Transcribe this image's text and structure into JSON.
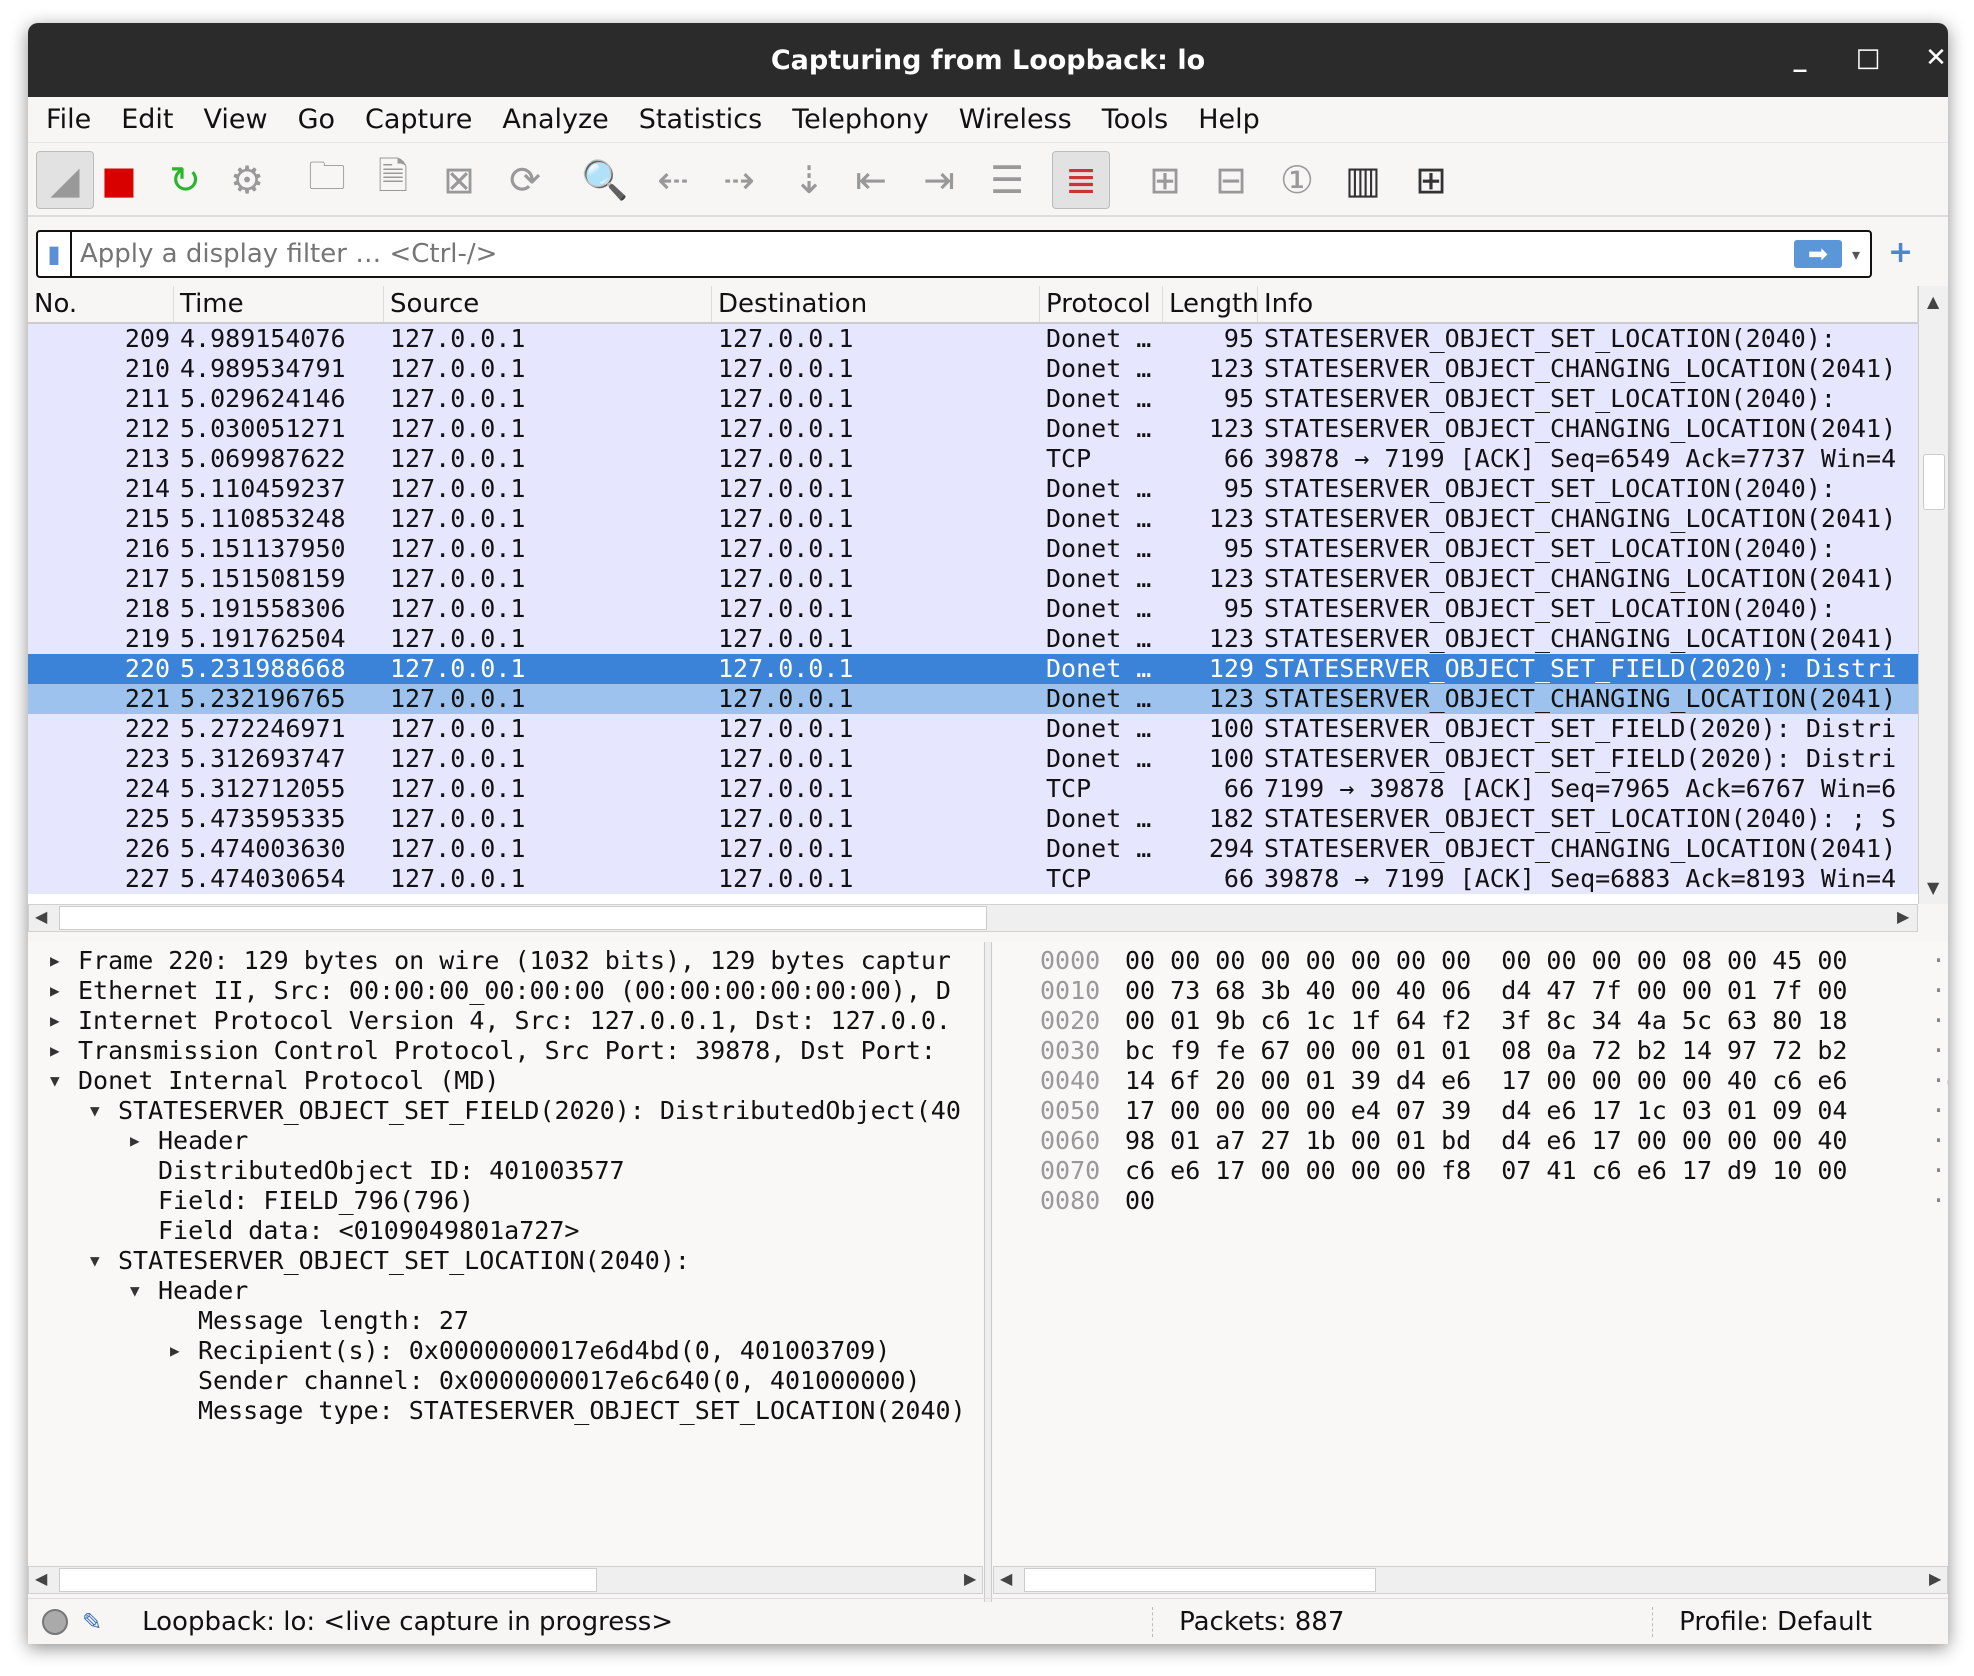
{
  "window": {
    "title": "Capturing from Loopback: lo",
    "minimize": "_",
    "maximize": "□",
    "close": "✕"
  },
  "menu": [
    "File",
    "Edit",
    "View",
    "Go",
    "Capture",
    "Analyze",
    "Statistics",
    "Telephony",
    "Wireless",
    "Tools",
    "Help"
  ],
  "toolbar": [
    {
      "name": "start-capture-icon",
      "glyph": "◢"
    },
    {
      "name": "stop-capture-icon",
      "glyph": "■",
      "color": "#d90000"
    },
    {
      "name": "restart-capture-icon",
      "glyph": "↻",
      "color": "#2ab52a"
    },
    {
      "name": "capture-options-icon",
      "glyph": "⚙"
    },
    {
      "name": "open-file-icon",
      "glyph": "🗀"
    },
    {
      "name": "save-file-icon",
      "glyph": "🗎"
    },
    {
      "name": "close-file-icon",
      "glyph": "⊠"
    },
    {
      "name": "reload-file-icon",
      "glyph": "⟳"
    },
    {
      "name": "find-packet-icon",
      "glyph": "🔍",
      "color": "#1d3d8f"
    },
    {
      "name": "go-back-icon",
      "glyph": "⇠"
    },
    {
      "name": "go-forward-icon",
      "glyph": "⇢"
    },
    {
      "name": "go-to-packet-icon",
      "glyph": "⇣"
    },
    {
      "name": "first-packet-icon",
      "glyph": "⇤"
    },
    {
      "name": "last-packet-icon",
      "glyph": "⇥"
    },
    {
      "name": "autoscroll-icon",
      "glyph": "☰"
    },
    {
      "name": "colorize-icon",
      "glyph": "≣",
      "color": "#c33"
    },
    {
      "name": "zoom-in-icon",
      "glyph": "⊞"
    },
    {
      "name": "zoom-out-icon",
      "glyph": "⊟"
    },
    {
      "name": "normal-size-icon",
      "glyph": "①"
    },
    {
      "name": "resize-columns-icon",
      "glyph": "▥",
      "color": "#333"
    },
    {
      "name": "layout-icon",
      "glyph": "⊞",
      "color": "#333"
    }
  ],
  "filter": {
    "placeholder": "Apply a display filter … <Ctrl-/>",
    "apply": "➡",
    "dropdown": "▾",
    "add": "+"
  },
  "columns": [
    "No.",
    "Time",
    "Source",
    "Destination",
    "Protocol",
    "Length",
    "Info"
  ],
  "packets": [
    [
      "209",
      "4.989154076",
      "127.0.0.1",
      "127.0.0.1",
      "Donet …",
      "95",
      "STATESERVER_OBJECT_SET_LOCATION(2040):"
    ],
    [
      "210",
      "4.989534791",
      "127.0.0.1",
      "127.0.0.1",
      "Donet …",
      "123",
      "STATESERVER_OBJECT_CHANGING_LOCATION(2041)"
    ],
    [
      "211",
      "5.029624146",
      "127.0.0.1",
      "127.0.0.1",
      "Donet …",
      "95",
      "STATESERVER_OBJECT_SET_LOCATION(2040):"
    ],
    [
      "212",
      "5.030051271",
      "127.0.0.1",
      "127.0.0.1",
      "Donet …",
      "123",
      "STATESERVER_OBJECT_CHANGING_LOCATION(2041)"
    ],
    [
      "213",
      "5.069987622",
      "127.0.0.1",
      "127.0.0.1",
      "TCP",
      "66",
      "39878 → 7199 [ACK] Seq=6549 Ack=7737 Win=4"
    ],
    [
      "214",
      "5.110459237",
      "127.0.0.1",
      "127.0.0.1",
      "Donet …",
      "95",
      "STATESERVER_OBJECT_SET_LOCATION(2040):"
    ],
    [
      "215",
      "5.110853248",
      "127.0.0.1",
      "127.0.0.1",
      "Donet …",
      "123",
      "STATESERVER_OBJECT_CHANGING_LOCATION(2041)"
    ],
    [
      "216",
      "5.151137950",
      "127.0.0.1",
      "127.0.0.1",
      "Donet …",
      "95",
      "STATESERVER_OBJECT_SET_LOCATION(2040):"
    ],
    [
      "217",
      "5.151508159",
      "127.0.0.1",
      "127.0.0.1",
      "Donet …",
      "123",
      "STATESERVER_OBJECT_CHANGING_LOCATION(2041)"
    ],
    [
      "218",
      "5.191558306",
      "127.0.0.1",
      "127.0.0.1",
      "Donet …",
      "95",
      "STATESERVER_OBJECT_SET_LOCATION(2040):"
    ],
    [
      "219",
      "5.191762504",
      "127.0.0.1",
      "127.0.0.1",
      "Donet …",
      "123",
      "STATESERVER_OBJECT_CHANGING_LOCATION(2041)"
    ],
    [
      "220",
      "5.231988668",
      "127.0.0.1",
      "127.0.0.1",
      "Donet …",
      "129",
      "STATESERVER_OBJECT_SET_FIELD(2020): Distri"
    ],
    [
      "221",
      "5.232196765",
      "127.0.0.1",
      "127.0.0.1",
      "Donet …",
      "123",
      "STATESERVER_OBJECT_CHANGING_LOCATION(2041)"
    ],
    [
      "222",
      "5.272246971",
      "127.0.0.1",
      "127.0.0.1",
      "Donet …",
      "100",
      "STATESERVER_OBJECT_SET_FIELD(2020): Distri"
    ],
    [
      "223",
      "5.312693747",
      "127.0.0.1",
      "127.0.0.1",
      "Donet …",
      "100",
      "STATESERVER_OBJECT_SET_FIELD(2020): Distri"
    ],
    [
      "224",
      "5.312712055",
      "127.0.0.1",
      "127.0.0.1",
      "TCP",
      "66",
      "7199 → 39878 [ACK] Seq=7965 Ack=6767 Win=6"
    ],
    [
      "225",
      "5.473595335",
      "127.0.0.1",
      "127.0.0.1",
      "Donet …",
      "182",
      "STATESERVER_OBJECT_SET_LOCATION(2040): ; S"
    ],
    [
      "226",
      "5.474003630",
      "127.0.0.1",
      "127.0.0.1",
      "Donet …",
      "294",
      "STATESERVER_OBJECT_CHANGING_LOCATION(2041)"
    ],
    [
      "227",
      "5.474030654",
      "127.0.0.1",
      "127.0.0.1",
      "TCP",
      "66",
      "39878 → 7199 [ACK] Seq=6883 Ack=8193 Win=4"
    ]
  ],
  "selected_packet": "220",
  "related_packet": "221",
  "colors": {
    "row": "#e7e6ff",
    "selected": "#3a83d9",
    "related": "#9ec2ee"
  },
  "details": [
    {
      "level": 0,
      "state": "collapsed",
      "text": "Frame 220: 129 bytes on wire (1032 bits), 129 bytes captur"
    },
    {
      "level": 0,
      "state": "collapsed",
      "text": "Ethernet II, Src: 00:00:00_00:00:00 (00:00:00:00:00:00), D"
    },
    {
      "level": 0,
      "state": "collapsed",
      "text": "Internet Protocol Version 4, Src: 127.0.0.1, Dst: 127.0.0."
    },
    {
      "level": 0,
      "state": "collapsed",
      "text": "Transmission Control Protocol, Src Port: 39878, Dst Port:"
    },
    {
      "level": 0,
      "state": "expanded",
      "text": "Donet Internal Protocol (MD)"
    },
    {
      "level": 1,
      "state": "expanded",
      "text": "STATESERVER_OBJECT_SET_FIELD(2020): DistributedObject(40"
    },
    {
      "level": 2,
      "state": "collapsed",
      "text": "Header"
    },
    {
      "level": 2,
      "state": "leaf",
      "text": "DistributedObject ID: 401003577"
    },
    {
      "level": 2,
      "state": "leaf",
      "text": "Field: FIELD_796(796)"
    },
    {
      "level": 2,
      "state": "leaf",
      "text": "Field data: <0109049801a727>"
    },
    {
      "level": 1,
      "state": "expanded",
      "text": "STATESERVER_OBJECT_SET_LOCATION(2040):"
    },
    {
      "level": 2,
      "state": "expanded",
      "text": "Header"
    },
    {
      "level": 3,
      "state": "leaf",
      "text": "Message length: 27"
    },
    {
      "level": 3,
      "state": "collapsed",
      "text": "Recipient(s): 0x0000000017e6d4bd(0, 401003709)"
    },
    {
      "level": 3,
      "state": "leaf",
      "text": "Sender channel: 0x0000000017e6c640(0, 401000000)"
    },
    {
      "level": 3,
      "state": "leaf",
      "text": "Message type: STATESERVER_OBJECT_SET_LOCATION(2040)"
    }
  ],
  "hex": [
    {
      "offset": "0000",
      "bytes": "00 00 00 00 00 00 00 00 00 00 00 00 08 00 45 00",
      "ascii": "···"
    },
    {
      "offset": "0010",
      "bytes": "00 73 68 3b 40 00 40 06 d4 47 7f 00 00 01 7f 00",
      "ascii": "·sh"
    },
    {
      "offset": "0020",
      "bytes": "00 01 9b c6 1c 1f 64 f2 3f 8c 34 4a 5c 63 80 18",
      "ascii": "···"
    },
    {
      "offset": "0030",
      "bytes": "bc f9 fe 67 00 00 01 01 08 0a 72 b2 14 97 72 b2",
      "ascii": "···"
    },
    {
      "offset": "0040",
      "bytes": "14 6f 20 00 01 39 d4 e6 17 00 00 00 00 40 c6 e6",
      "ascii": "·o"
    },
    {
      "offset": "0050",
      "bytes": "17 00 00 00 00 e4 07 39 d4 e6 17 1c 03 01 09 04",
      "ascii": "···"
    },
    {
      "offset": "0060",
      "bytes": "98 01 a7 27 1b 00 01 bd d4 e6 17 00 00 00 00 40",
      "ascii": "···"
    },
    {
      "offset": "0070",
      "bytes": "c6 e6 17 00 00 00 00 f8 07 41 c6 e6 17 d9 10 00",
      "ascii": "···"
    },
    {
      "offset": "0080",
      "bytes": "00",
      "ascii": "·"
    }
  ],
  "status": {
    "capture": "Loopback: lo: <live capture in progress>",
    "packets": "Packets: 887",
    "profile": "Profile: Default"
  }
}
